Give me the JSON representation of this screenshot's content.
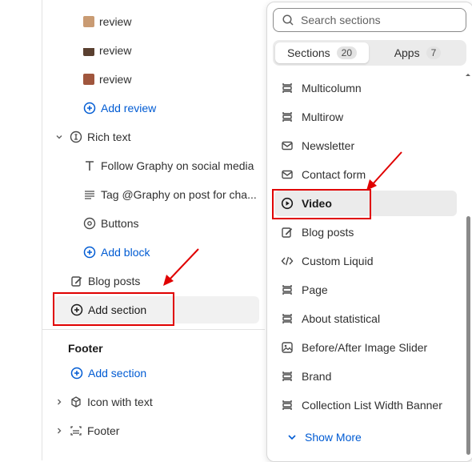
{
  "left": {
    "reviews": [
      {
        "label": "review",
        "thumb_color": "#c99b73"
      },
      {
        "label": "review",
        "thumb_color": "#5a4030"
      },
      {
        "label": "review",
        "thumb_color": "#a0563d"
      }
    ],
    "add_review": "Add review",
    "rich_text": "Rich text",
    "rich_text_children": [
      {
        "label": "Follow Graphy on social media",
        "icon": "text-icon"
      },
      {
        "label": "Tag @Graphy on post for cha...",
        "icon": "paragraph-icon"
      },
      {
        "label": "Buttons",
        "icon": "buttons-icon"
      }
    ],
    "add_block": "Add block",
    "blog_posts": "Blog posts",
    "add_section": "Add section",
    "footer_heading": "Footer",
    "footer_add_section": "Add section",
    "icon_with_text": "Icon with text",
    "footer": "Footer"
  },
  "popover": {
    "search_placeholder": "Search sections",
    "tabs": [
      {
        "label": "Sections",
        "count": "20"
      },
      {
        "label": "Apps",
        "count": "7"
      }
    ],
    "items": [
      {
        "label": "Multicolumn",
        "icon": "section-icon"
      },
      {
        "label": "Multirow",
        "icon": "section-icon"
      },
      {
        "label": "Newsletter",
        "icon": "email-icon"
      },
      {
        "label": "Contact form",
        "icon": "email-icon"
      },
      {
        "label": "Video",
        "icon": "play-icon"
      },
      {
        "label": "Blog posts",
        "icon": "edit-icon"
      },
      {
        "label": "Custom Liquid",
        "icon": "code-icon"
      },
      {
        "label": "Page",
        "icon": "section-icon"
      },
      {
        "label": "About statistical",
        "icon": "section-icon"
      },
      {
        "label": "Before/After Image Slider",
        "icon": "image-icon"
      },
      {
        "label": "Brand",
        "icon": "section-icon"
      },
      {
        "label": "Collection List Width Banner",
        "icon": "section-icon"
      }
    ],
    "show_more": "Show More"
  },
  "colors": {
    "accent": "#005bd3",
    "annotation": "#e00000"
  }
}
